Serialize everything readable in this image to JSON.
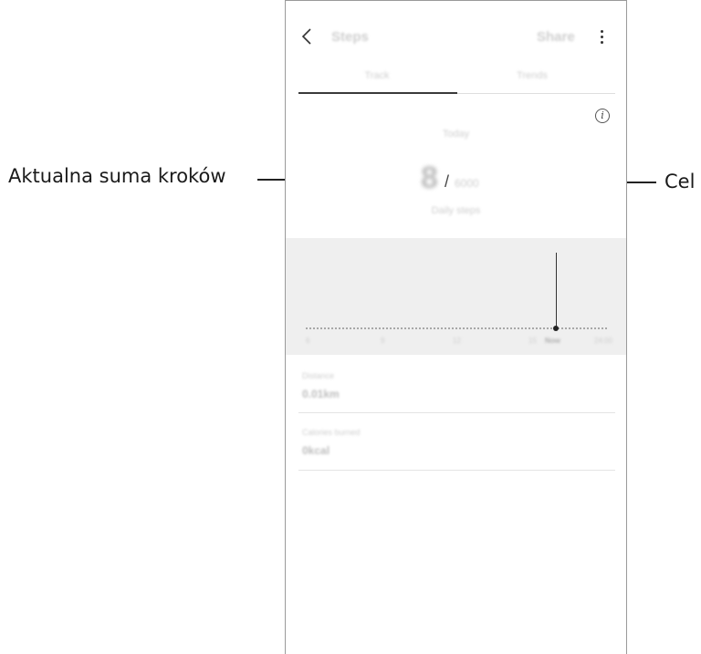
{
  "callouts": {
    "left_label": "Aktualna suma kroków",
    "right_label": "Cel"
  },
  "appbar": {
    "title": "Steps",
    "share_label": "Share"
  },
  "tabs": [
    {
      "label": "Track",
      "active": true
    },
    {
      "label": "Trends",
      "active": false
    }
  ],
  "summary": {
    "date": "Today",
    "current_steps": "8",
    "slash": "/",
    "target": "6000",
    "target_caption": "Daily steps"
  },
  "graph": {
    "tick_labels": [
      "6",
      "9",
      "12",
      "15",
      "Now",
      "24:00"
    ]
  },
  "stats": [
    {
      "label": "Distance",
      "value": "0.01km"
    },
    {
      "label": "Calories burned",
      "value": "0kcal"
    }
  ],
  "icons": {
    "back": "chevron-left-icon",
    "more": "more-vertical-icon",
    "info": "info-circle-icon"
  }
}
